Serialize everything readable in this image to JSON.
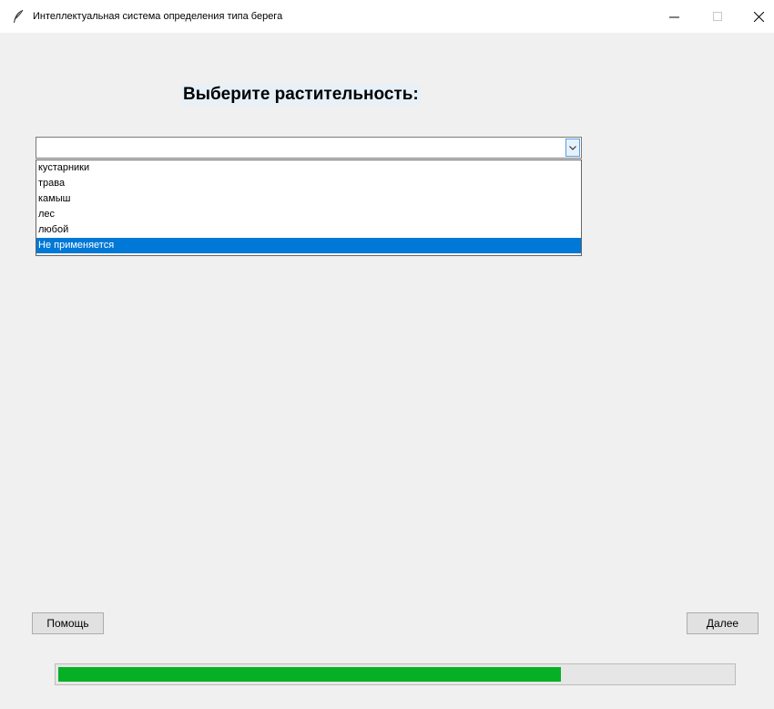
{
  "window": {
    "title": "Интеллектуальная система определения типа берега",
    "app_icon": "feather-icon",
    "controls": [
      "minimize-icon",
      "maximize-icon",
      "close-icon"
    ]
  },
  "main": {
    "heading": "Выберите растительность:",
    "combobox": {
      "value": "",
      "arrow_icon": "chevron-down-icon",
      "options": [
        "кустарники",
        "трава",
        "камыш",
        "лес",
        "любой",
        "Не применяется"
      ],
      "highlighted_option": "Не применяется"
    }
  },
  "buttons": {
    "help_label": "Помощь",
    "next_label": "Далее"
  },
  "progress": {
    "fraction": 0.746,
    "color": "#06b025"
  }
}
